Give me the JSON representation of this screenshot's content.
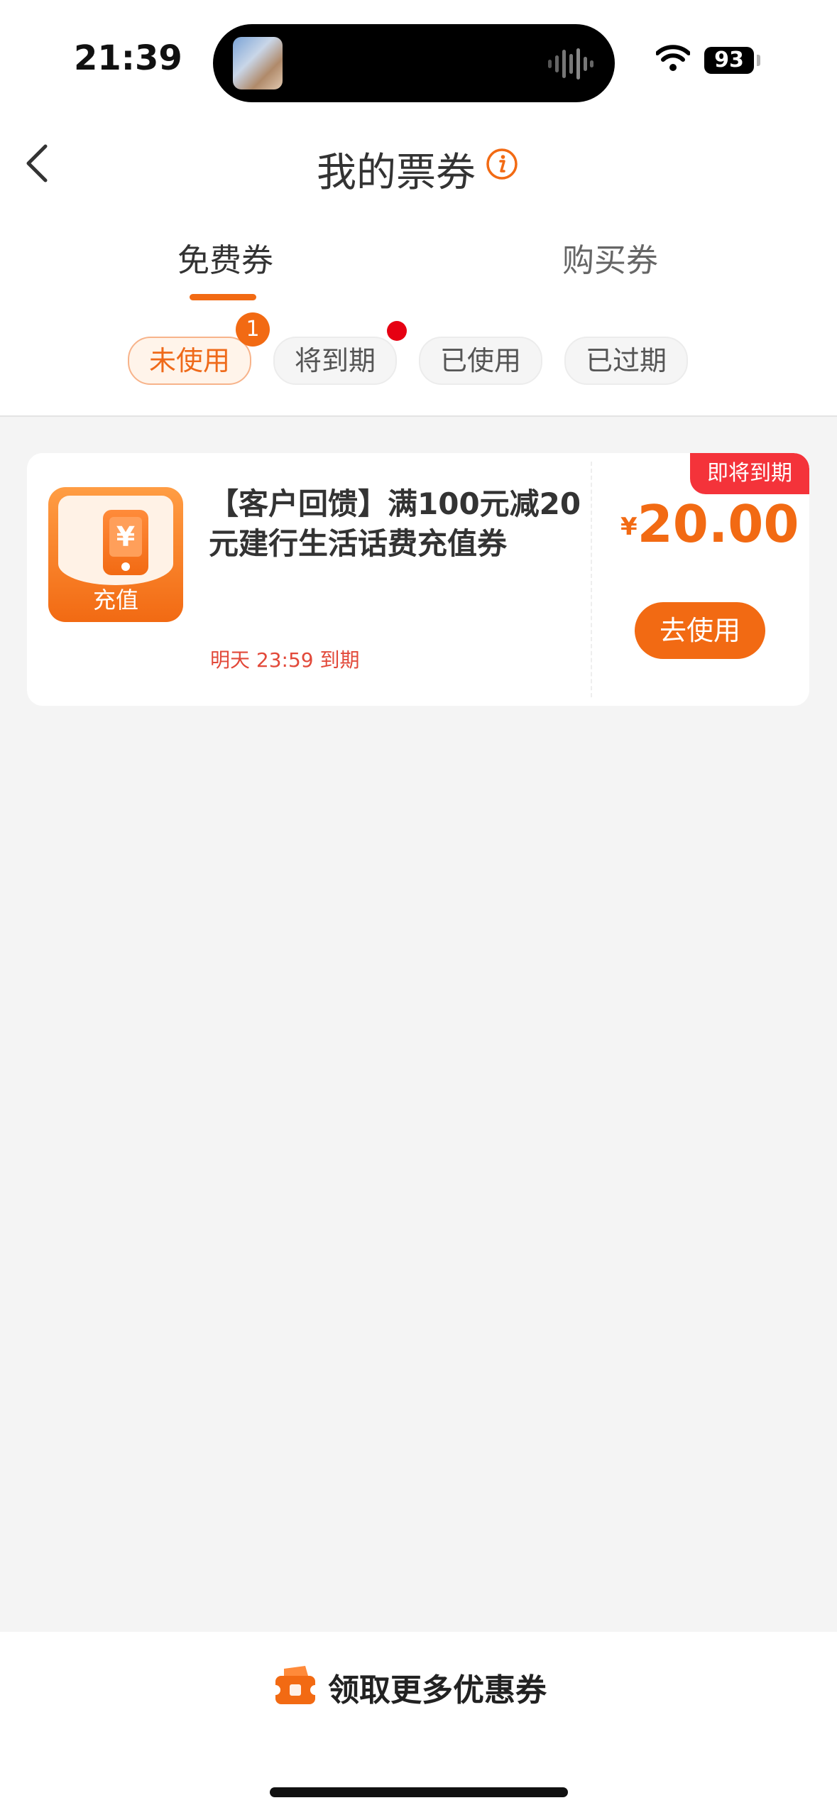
{
  "status_bar": {
    "time": "21:39",
    "battery": "93"
  },
  "header": {
    "title": "我的票券"
  },
  "tabs": [
    {
      "label": "免费券",
      "active": true
    },
    {
      "label": "购买券",
      "active": false
    }
  ],
  "filters": [
    {
      "label": "未使用",
      "active": true,
      "badge": "1"
    },
    {
      "label": "将到期",
      "active": false,
      "dot": true
    },
    {
      "label": "已使用",
      "active": false
    },
    {
      "label": "已过期",
      "active": false
    }
  ],
  "coupon": {
    "icon_label": "充值",
    "icon_symbol": "¥",
    "title": "【客户回馈】满100元减20元建行生活话费充值券",
    "expiry": "明天 23:59 到期",
    "tag": "即将到期",
    "currency": "¥",
    "amount": "20.00",
    "action": "去使用"
  },
  "footer": {
    "more_label": "领取更多优惠券"
  },
  "colors": {
    "accent": "#f26a13",
    "alert": "#f4333a",
    "background": "#f4f4f4"
  }
}
